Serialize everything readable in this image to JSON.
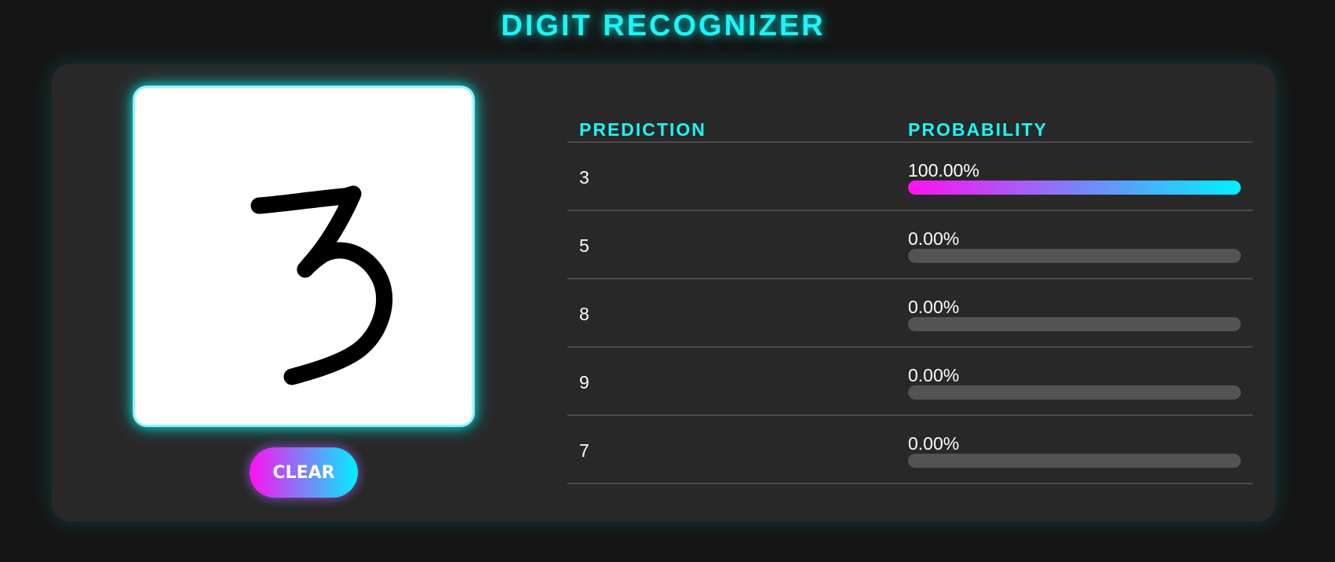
{
  "app": {
    "title": "DIGIT RECOGNIZER"
  },
  "canvas": {
    "drawn_digit_icon": "handwritten-three-icon",
    "background": "#ffffff"
  },
  "controls": {
    "clear_label": "CLEAR"
  },
  "results": {
    "headers": {
      "prediction": "PREDICTION",
      "probability": "PROBABILITY"
    },
    "rows": [
      {
        "digit": "3",
        "probability_label": "100.00%",
        "probability": 1.0
      },
      {
        "digit": "5",
        "probability_label": "0.00%",
        "probability": 0.0
      },
      {
        "digit": "8",
        "probability_label": "0.00%",
        "probability": 0.0
      },
      {
        "digit": "9",
        "probability_label": "0.00%",
        "probability": 0.0
      },
      {
        "digit": "7",
        "probability_label": "0.00%",
        "probability": 0.0
      }
    ]
  },
  "colors": {
    "accent_cyan": "#1ef4f4",
    "accent_magenta": "#ff10f0",
    "panel": "#282828",
    "page_background": "#151515",
    "track": "#535353"
  }
}
